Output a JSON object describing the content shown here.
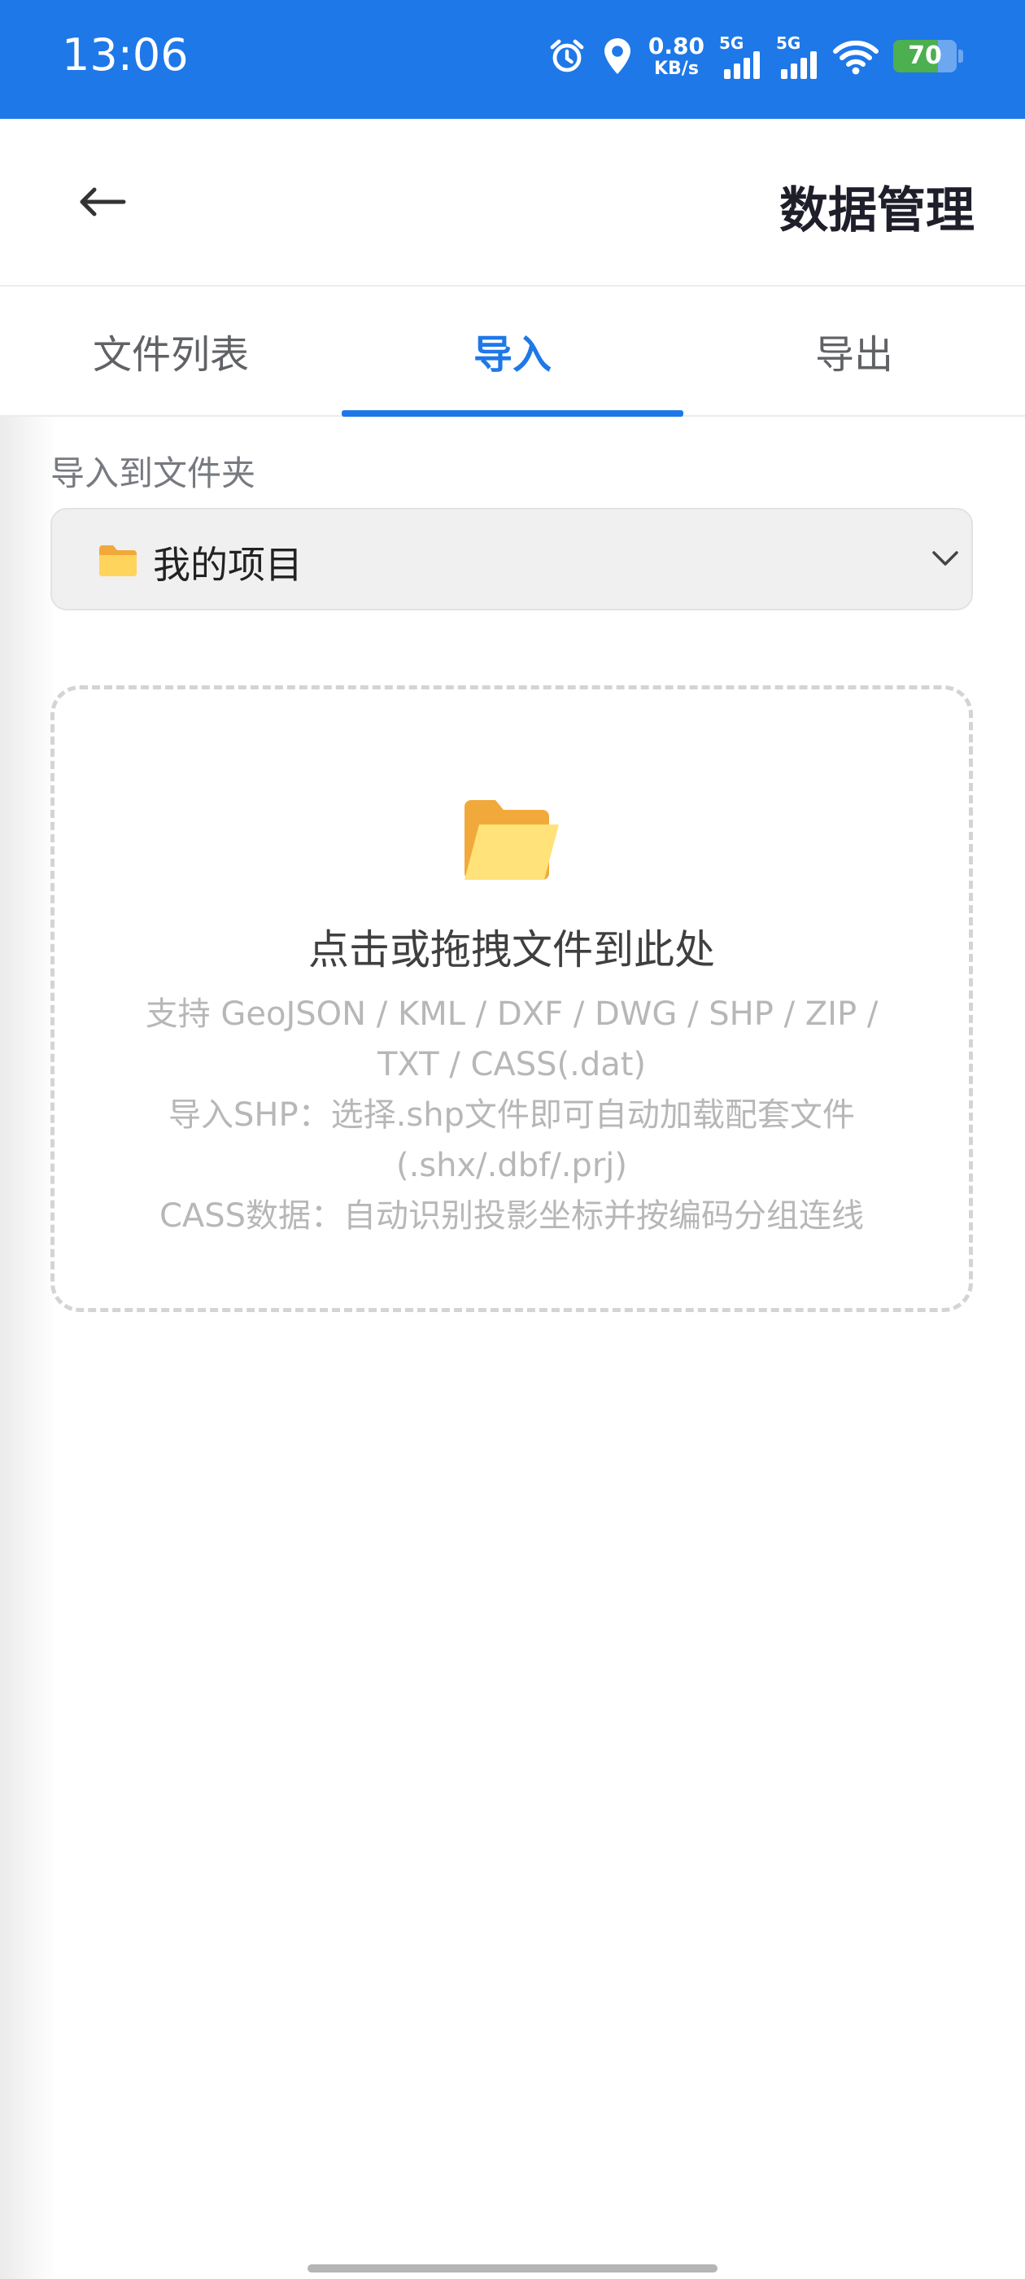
{
  "status_bar": {
    "time": "13:06",
    "net_speed_value": "0.80",
    "net_speed_unit": "KB/s",
    "signal_1_label": "5G",
    "signal_2_label": "5G",
    "battery_level": "70",
    "icons": [
      "alarm-icon",
      "location-icon",
      "signal-icon",
      "signal-icon",
      "wifi-icon",
      "battery-icon"
    ]
  },
  "header": {
    "back_icon": "back-arrow-icon",
    "title": "数据管理"
  },
  "tabs": [
    {
      "label": "文件列表",
      "active": false
    },
    {
      "label": "导入",
      "active": true
    },
    {
      "label": "导出",
      "active": false
    }
  ],
  "import": {
    "target_label": "导入到文件夹",
    "selected_folder": "我的项目",
    "folder_icon": "folder-icon",
    "dropdown_icon": "chevron-down-icon"
  },
  "dropzone": {
    "icon": "open-folder-icon",
    "title": "点击或拖拽文件到此处",
    "lines": [
      "支持 GeoJSON / KML / DXF / DWG / SHP / ZIP /",
      "TXT / CASS(.dat)",
      "导入SHP：选择.shp文件即可自动加载配套文件",
      "(.shx/.dbf/.prj)",
      "CASS数据：自动识别投影坐标并按编码分组连线"
    ]
  },
  "colors": {
    "primary": "#1e78e8",
    "battery": "#4caf50",
    "muted_text": "#b7b7b7"
  }
}
